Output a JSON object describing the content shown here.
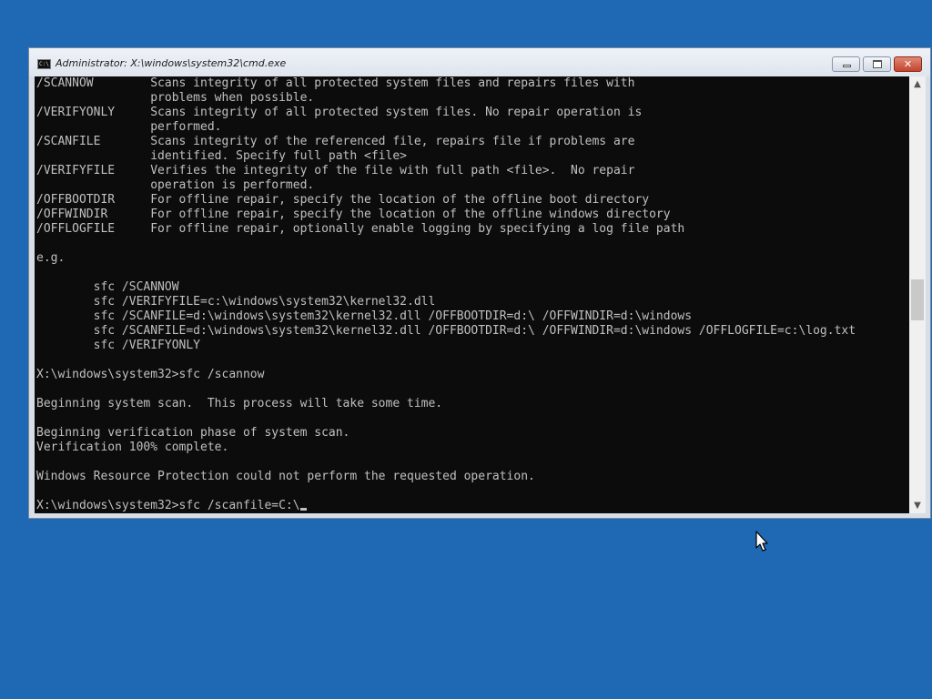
{
  "window": {
    "title": "Administrator: X:\\windows\\system32\\cmd.exe",
    "icon_label": "C:\\"
  },
  "console": {
    "lines": [
      "/SCANNOW        Scans integrity of all protected system files and repairs files with",
      "                problems when possible.",
      "/VERIFYONLY     Scans integrity of all protected system files. No repair operation is",
      "                performed.",
      "/SCANFILE       Scans integrity of the referenced file, repairs file if problems are",
      "                identified. Specify full path <file>",
      "/VERIFYFILE     Verifies the integrity of the file with full path <file>.  No repair",
      "                operation is performed.",
      "/OFFBOOTDIR     For offline repair, specify the location of the offline boot directory",
      "/OFFWINDIR      For offline repair, specify the location of the offline windows directory",
      "/OFFLOGFILE     For offline repair, optionally enable logging by specifying a log file path",
      "",
      "e.g.",
      "",
      "        sfc /SCANNOW",
      "        sfc /VERIFYFILE=c:\\windows\\system32\\kernel32.dll",
      "        sfc /SCANFILE=d:\\windows\\system32\\kernel32.dll /OFFBOOTDIR=d:\\ /OFFWINDIR=d:\\windows",
      "        sfc /SCANFILE=d:\\windows\\system32\\kernel32.dll /OFFBOOTDIR=d:\\ /OFFWINDIR=d:\\windows /OFFLOGFILE=c:\\log.txt",
      "        sfc /VERIFYONLY",
      "",
      "X:\\windows\\system32>sfc /scannow",
      "",
      "Beginning system scan.  This process will take some time.",
      "",
      "Beginning verification phase of system scan.",
      "Verification 100% complete.",
      "",
      "Windows Resource Protection could not perform the requested operation.",
      ""
    ],
    "prompt_line": "X:\\windows\\system32>sfc /scanfile=C:\\"
  },
  "scrollbar": {
    "up_icon": "scroll-up-arrow",
    "down_icon": "scroll-down-arrow",
    "position_fraction": 0.47
  }
}
